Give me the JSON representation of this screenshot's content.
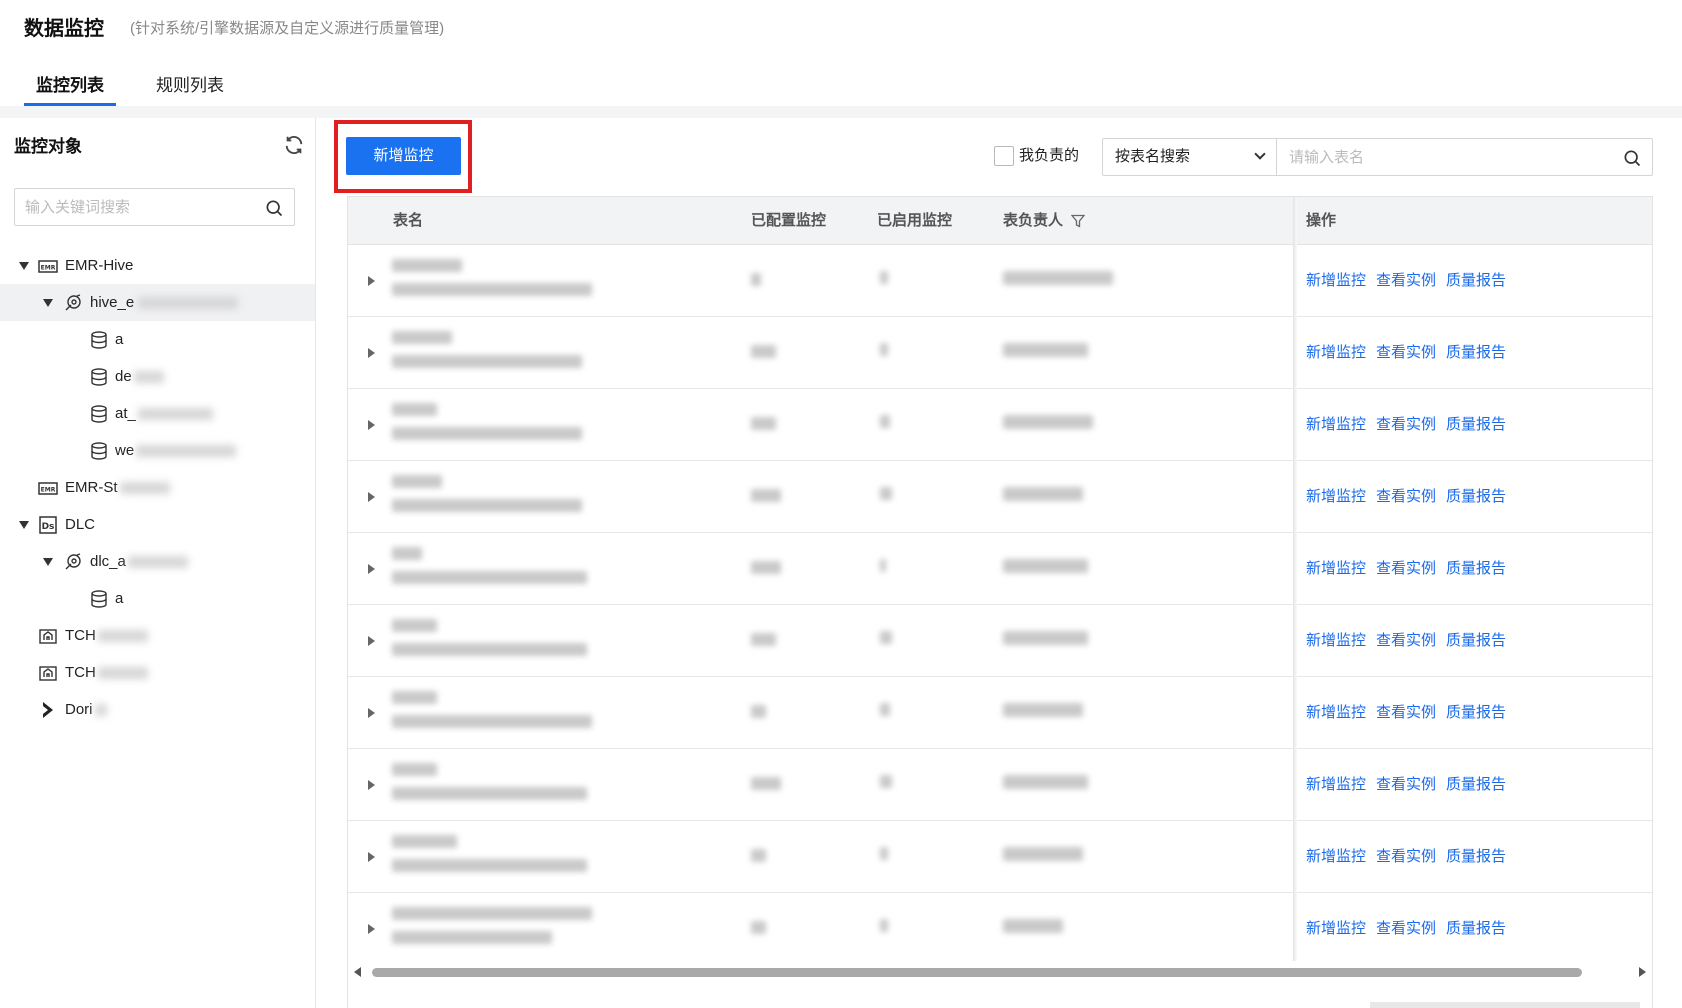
{
  "header": {
    "title": "数据监控",
    "subtitle": "(针对系统/引擎数据源及自定义源进行质量管理)"
  },
  "tabs": [
    {
      "label": "监控列表",
      "active": true
    },
    {
      "label": "规则列表",
      "active": false
    }
  ],
  "left_panel": {
    "title": "监控对象",
    "search_placeholder": "输入关键词搜索",
    "tree": [
      {
        "label": "EMR-Hive",
        "icon": "emr-icon",
        "expanded": true
      },
      {
        "label": "hive_e",
        "icon": "cluster-icon",
        "expanded": true,
        "selected": true
      },
      {
        "label": "a",
        "icon": "database-icon"
      },
      {
        "label": "de",
        "icon": "database-icon"
      },
      {
        "label": "at_",
        "icon": "database-icon"
      },
      {
        "label": "we",
        "icon": "database-icon"
      },
      {
        "label": "EMR-St",
        "icon": "emr-icon"
      },
      {
        "label": "DLC",
        "icon": "dlc-icon",
        "expanded": true
      },
      {
        "label": "dlc_a",
        "icon": "cluster-icon",
        "expanded": true
      },
      {
        "label": "a",
        "icon": "database-icon"
      },
      {
        "label": "TCH",
        "icon": "tchouse-icon"
      },
      {
        "label": "TCH",
        "icon": "tchouse-icon"
      },
      {
        "label": "Dori",
        "icon": "doris-icon"
      }
    ]
  },
  "toolbar": {
    "add_button": "新增监控",
    "mine_label": "我负责的",
    "search_type": "按表名搜索",
    "search_placeholder": "请输入表名"
  },
  "table": {
    "columns": {
      "name": "表名",
      "configured": "已配置监控",
      "enabled": "已启用监控",
      "owner": "表负责人",
      "ops": "操作"
    },
    "row_actions": [
      "新增监控",
      "查看实例",
      "质量报告"
    ],
    "row_count": 10
  },
  "colors": {
    "primary": "#1a72f0",
    "link": "#1a6ae9",
    "highlight_frame": "#e02020"
  }
}
